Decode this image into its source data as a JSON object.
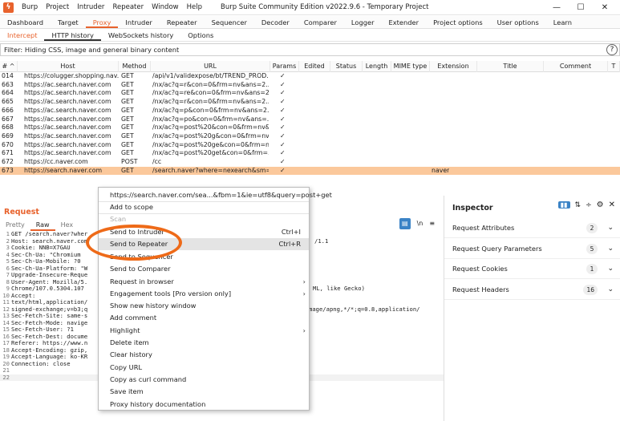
{
  "titlebar": {
    "menu": [
      "Burp",
      "Project",
      "Intruder",
      "Repeater",
      "Window",
      "Help"
    ],
    "title": "Burp Suite Community Edition v2022.9.6 - Temporary Project",
    "minimize": "—",
    "maximize": "☐",
    "close": "✕"
  },
  "main_tabs": [
    "Dashboard",
    "Target",
    "Proxy",
    "Intruder",
    "Repeater",
    "Sequencer",
    "Decoder",
    "Comparer",
    "Logger",
    "Extender",
    "Project options",
    "User options",
    "Learn"
  ],
  "proxy_tabs": [
    "Intercept",
    "HTTP history",
    "WebSockets history",
    "Options"
  ],
  "filter": {
    "text": "Filter: Hiding CSS, image and general binary content",
    "help": "?"
  },
  "table": {
    "headers": [
      "# ^",
      "Host",
      "Method",
      "URL",
      "Params",
      "Edited",
      "Status",
      "Length",
      "MIME type",
      "Extension",
      "Title",
      "Comment",
      "T"
    ],
    "rows": [
      {
        "num": "014",
        "host": "https://colugger.shopping.nav...",
        "method": "GET",
        "url": "/api/v1/validexpose/bt/TREND_PROD...",
        "params": "✓",
        "ext": ""
      },
      {
        "num": "663",
        "host": "https://ac.search.naver.com",
        "method": "GET",
        "url": "/nx/ac?q=r&con=0&frm=nv&ans=2...",
        "params": "✓",
        "ext": ""
      },
      {
        "num": "664",
        "host": "https://ac.search.naver.com",
        "method": "GET",
        "url": "/nx/ac?q=re&con=0&frm=nv&ans=2...",
        "params": "✓",
        "ext": ""
      },
      {
        "num": "665",
        "host": "https://ac.search.naver.com",
        "method": "GET",
        "url": "/nx/ac?q=r&con=0&frm=nv&ans=2...",
        "params": "✓",
        "ext": ""
      },
      {
        "num": "666",
        "host": "https://ac.search.naver.com",
        "method": "GET",
        "url": "/nx/ac?q=p&con=0&frm=nv&ans=2...",
        "params": "✓",
        "ext": ""
      },
      {
        "num": "667",
        "host": "https://ac.search.naver.com",
        "method": "GET",
        "url": "/nx/ac?q=po&con=0&frm=nv&ans=...",
        "params": "✓",
        "ext": ""
      },
      {
        "num": "668",
        "host": "https://ac.search.naver.com",
        "method": "GET",
        "url": "/nx/ac?q=post%20&con=0&frm=nv&...",
        "params": "✓",
        "ext": ""
      },
      {
        "num": "669",
        "host": "https://ac.search.naver.com",
        "method": "GET",
        "url": "/nx/ac?q=post%20g&con=0&frm=nv...",
        "params": "✓",
        "ext": ""
      },
      {
        "num": "670",
        "host": "https://ac.search.naver.com",
        "method": "GET",
        "url": "/nx/ac?q=post%20ge&con=0&frm=n...",
        "params": "✓",
        "ext": ""
      },
      {
        "num": "671",
        "host": "https://ac.search.naver.com",
        "method": "GET",
        "url": "/nx/ac?q=post%20get&con=0&frm=...",
        "params": "✓",
        "ext": ""
      },
      {
        "num": "672",
        "host": "https://cc.naver.com",
        "method": "POST",
        "url": "/cc",
        "params": "✓",
        "ext": ""
      },
      {
        "num": "673",
        "host": "https://search.naver.com",
        "method": "GET",
        "url": "/search.naver?where=nexearch&sm=...",
        "params": "✓",
        "ext": "naver"
      }
    ]
  },
  "request": {
    "title": "Request",
    "tabs": [
      "Pretty",
      "Raw",
      "Hex"
    ],
    "ln_label": "\\n",
    "menu_icon": "≡",
    "lines": [
      "GET /search.naver?wher",
      "Host: search.naver.com",
      "Cookie: NNB=X7GAU",
      "Sec-Ch-Ua: \"Chromium",
      "Sec-Ch-Ua-Mobile: ?0",
      "Sec-Ch-Ua-Platform: \"W",
      "Upgrade-Insecure-Reque",
      "User-Agent: Mozilla/5.",
      "Chrome/107.0.5304.107",
      "Accept:",
      "text/html,application/",
      "signed-exchange;v=b3;q",
      "Sec-Fetch-Site: same-s",
      "Sec-Fetch-Mode: navige",
      "Sec-Fetch-User: ?1",
      "Sec-Fetch-Dest: docume",
      "Referer: https://www.n",
      "Accept-Encoding: gzip,",
      "Accept-Language: ko-KR",
      "Connection: close",
      "",
      ""
    ],
    "right_fragments": [
      {
        "line": 1,
        "text": "/1.1"
      },
      {
        "line": 8,
        "text": "ML, like Gecko)"
      },
      {
        "line": 11,
        "text": "mage/apng,*/*;q=0.8,application/"
      }
    ]
  },
  "inspector": {
    "title": "Inspector",
    "rows": [
      {
        "label": "Request Attributes",
        "count": "2"
      },
      {
        "label": "Request Query Parameters",
        "count": "5"
      },
      {
        "label": "Request Cookies",
        "count": "1"
      },
      {
        "label": "Request Headers",
        "count": "16"
      }
    ]
  },
  "context_menu": {
    "items": [
      {
        "label": "https://search.naver.com/sea...&fbm=1&ie=utf8&query=post+get",
        "shortcut": "",
        "disabled": false,
        "arrow": false
      },
      {
        "label": "Add to scope",
        "shortcut": "",
        "disabled": false,
        "arrow": false
      },
      {
        "label": "Scan",
        "shortcut": "",
        "disabled": true,
        "arrow": false
      },
      {
        "label": "Send to Intruder",
        "shortcut": "Ctrl+I",
        "disabled": false,
        "arrow": false
      },
      {
        "label": "Send to Repeater",
        "shortcut": "Ctrl+R",
        "disabled": false,
        "arrow": false,
        "hover": true
      },
      {
        "label": "Send to Sequencer",
        "shortcut": "",
        "disabled": false,
        "arrow": false
      },
      {
        "label": "Send to Comparer",
        "shortcut": "",
        "disabled": false,
        "arrow": false
      },
      {
        "label": "Request in browser",
        "shortcut": "",
        "disabled": false,
        "arrow": true
      },
      {
        "label": "Engagement tools [Pro version only]",
        "shortcut": "",
        "disabled": false,
        "arrow": true
      },
      {
        "label": "Show new history window",
        "shortcut": "",
        "disabled": false,
        "arrow": false
      },
      {
        "label": "Add comment",
        "shortcut": "",
        "disabled": false,
        "arrow": false
      },
      {
        "label": "Highlight",
        "shortcut": "",
        "disabled": false,
        "arrow": true
      },
      {
        "label": "Delete item",
        "shortcut": "",
        "disabled": false,
        "arrow": false
      },
      {
        "label": "Clear history",
        "shortcut": "",
        "disabled": false,
        "arrow": false
      },
      {
        "label": "Copy URL",
        "shortcut": "",
        "disabled": false,
        "arrow": false
      },
      {
        "label": "Copy as curl command",
        "shortcut": "",
        "disabled": false,
        "arrow": false
      },
      {
        "label": "Save item",
        "shortcut": "",
        "disabled": false,
        "arrow": false
      },
      {
        "label": "Proxy history documentation",
        "shortcut": "",
        "disabled": false,
        "arrow": false
      }
    ]
  },
  "colors": {
    "accent": "#e8622c",
    "highlight_row": "#fbc89b",
    "annotation": "#ee6a18"
  }
}
